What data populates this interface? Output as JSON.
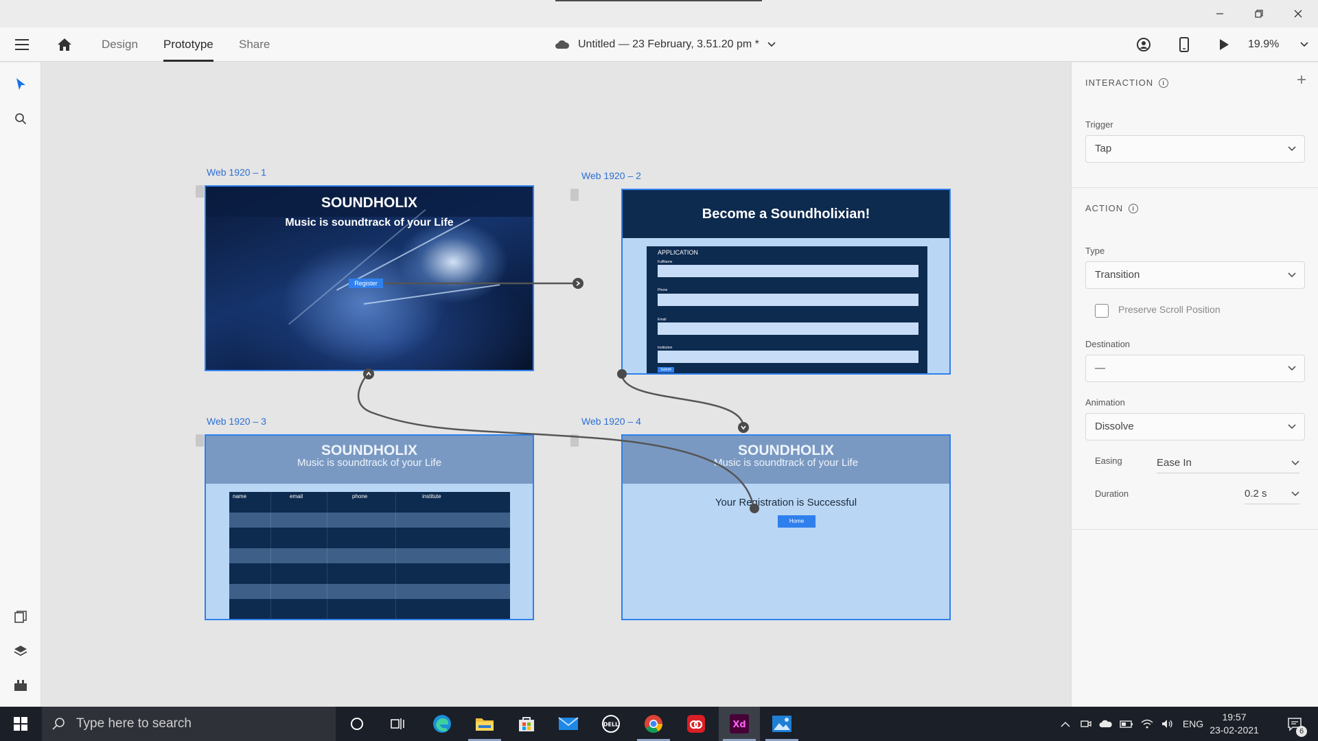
{
  "window": {
    "minimize_icon": "minimize-icon",
    "restore_icon": "restore-icon",
    "close_icon": "close-icon"
  },
  "topbar": {
    "tabs": [
      {
        "label": "Design"
      },
      {
        "label": "Prototype"
      },
      {
        "label": "Share"
      }
    ],
    "doc_title": "Untitled — 23 February, 3.51.20 pm *",
    "zoom": "19.9%"
  },
  "canvas": {
    "artboards": [
      {
        "label": "Web 1920 – 1",
        "title": "SOUNDHOLIX",
        "subtitle": "Music is soundtrack of your Life",
        "button": "Register"
      },
      {
        "label": "Web 1920 – 2",
        "title": "Become a Soundholixian!",
        "form_title": "APPLICATION",
        "fields": [
          "FullName",
          "Phone",
          "Email",
          "Institution"
        ],
        "button": "Submit"
      },
      {
        "label": "Web 1920 – 3",
        "title": "SOUNDHOLIX",
        "subtitle": "Music is soundtrack of your Life",
        "columns": [
          "name",
          "email",
          "phone",
          "institute"
        ]
      },
      {
        "label": "Web 1920 – 4",
        "title": "SOUNDHOLIX",
        "subtitle": "Music is soundtrack of your Life",
        "message": "Your Registration is Successful",
        "button": "Home"
      }
    ]
  },
  "panel": {
    "interaction": {
      "title": "INTERACTION",
      "trigger_label": "Trigger",
      "trigger_value": "Tap"
    },
    "action": {
      "title": "ACTION",
      "type_label": "Type",
      "type_value": "Transition",
      "preserve_scroll": "Preserve Scroll Position",
      "destination_label": "Destination",
      "destination_value": "—",
      "animation_label": "Animation",
      "animation_value": "Dissolve",
      "easing_label": "Easing",
      "easing_value": "Ease In",
      "duration_label": "Duration",
      "duration_value": "0.2 s"
    }
  },
  "taskbar": {
    "search_placeholder": "Type here to search",
    "language": "ENG",
    "time": "19:57",
    "date": "23-02-2021",
    "notifications": "6",
    "colors": {
      "xd_bg": "#470137",
      "xd_fg": "#ff61f6",
      "accent": "#2f80ed"
    }
  }
}
